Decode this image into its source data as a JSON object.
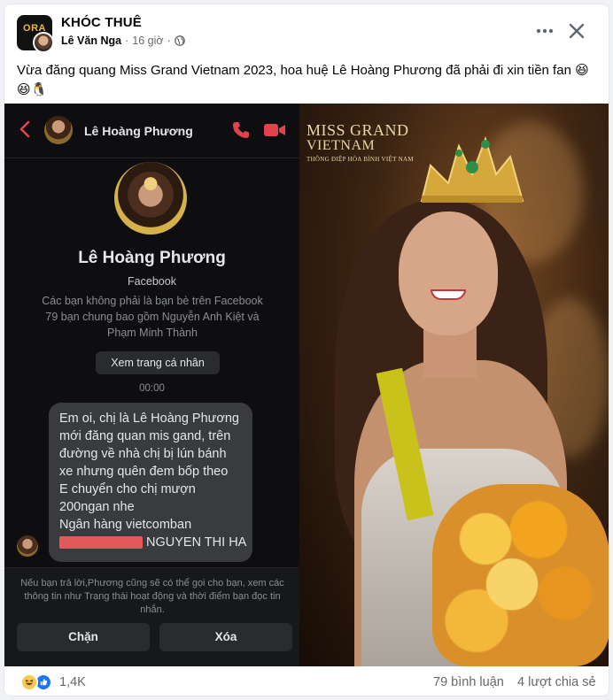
{
  "post": {
    "group_name": "KHÓC THUÊ",
    "author": "Lê Văn Nga",
    "time": "16 giờ",
    "separator": "·",
    "caption": "Vừa đăng quang Miss Grand Vietnam 2023, hoa huệ Lê Hoàng Phương đã phải đi xin tiền fan 😆 😆🐧",
    "group_avatar_text": "ORA"
  },
  "chat": {
    "header_name": "Lê Hoàng Phương",
    "profile_name": "Lê Hoàng Phương",
    "profile_sub": "Facebook",
    "profile_note_1": "Các bạn không phải là bạn bè trên Facebook",
    "profile_note_2": "79 bạn chung bao gồm Nguyễn Anh Kiệt và",
    "profile_note_3": "Phạm Minh Thành",
    "view_profile_label": "Xem trang cá nhân",
    "timestamp": "00:00",
    "message_lines": [
      "Em oi, chị là Lê Hoàng Phương",
      "mới đăng quan mis gand, trên",
      "đường về nhà chị bị lún bánh",
      "xe nhưng quên đem bốp theo",
      "E chuyển cho chị mượn",
      "200ngan nhe",
      "Ngân hàng vietcomban"
    ],
    "account_name": "NGUYEN THI HA",
    "footer_note": "Nếu bạn trả lời,Phương cũng sẽ có thể gọi cho bạn, xem các thông tin như Trạng thái hoạt động và thời điểm bạn đọc tin nhắn.",
    "block_label": "Chặn",
    "delete_label": "Xóa"
  },
  "photo": {
    "logo_line1": "MISS GRAND",
    "logo_line2": "VIETNAM",
    "logo_line3": "THÔNG ĐIỆP HÒA BÌNH VIỆT NAM"
  },
  "stats": {
    "reactions": "1,4K",
    "comments": "79 bình luận",
    "shares": "4 lượt chia sẻ"
  },
  "colors": {
    "accent_red": "#e0434b",
    "like_blue": "#1877f2",
    "muted": "#65676b"
  }
}
